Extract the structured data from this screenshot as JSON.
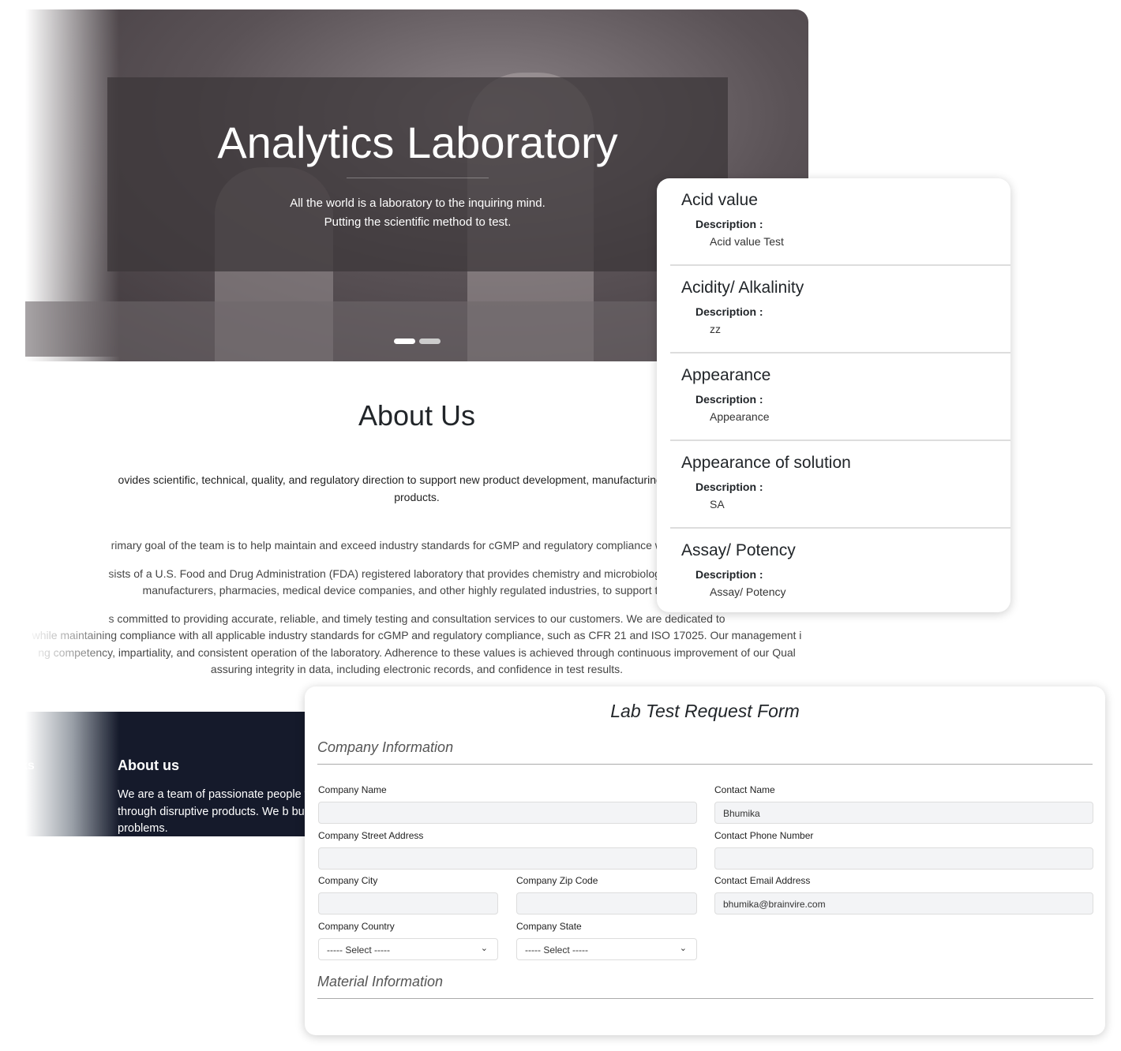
{
  "hero": {
    "title": "Analytics Laboratory",
    "line1": "All the world is a laboratory to the inquiring mind.",
    "line2": "Putting the scientific method to test."
  },
  "about": {
    "title": "About Us",
    "lead1": "ovides scientific, technical, quality, and regulatory direction to support new product development, manufacturing processes",
    "lead2": "products.",
    "p1": "rimary goal of the team is to help maintain and exceed industry standards for cGMP and regulatory compliance with a focus o",
    "p2a": "sists of a U.S. Food and Drug Administration (FDA) registered laboratory that provides chemistry and microbiological testing fo",
    "p2b": "manufacturers, pharmacies, medical device companies, and other highly regulated industries, to support their co",
    "p3a": "s committed to providing accurate, reliable, and timely testing and consultation services to our customers. We are dedicated to",
    "p3b": "while maintaining compliance with all applicable industry standards for cGMP and regulatory compliance, such as CFR 21 and ISO 17025. Our management i",
    "p3c": "ng competency, impartiality, and consistent operation of the laboratory. Adherence to these values is achieved through continuous improvement of our Qual",
    "p3d": "assuring integrity in data, including electronic records, and confidence in test results."
  },
  "footer": {
    "links": "ks",
    "title": "About us",
    "text": "We are a team of passionate people w life through disruptive products. We b business problems."
  },
  "tests": [
    {
      "name": "Acid value",
      "label": "Description :",
      "desc": "Acid value Test"
    },
    {
      "name": "Acidity/ Alkalinity",
      "label": "Description :",
      "desc": "zz"
    },
    {
      "name": "Appearance",
      "label": "Description :",
      "desc": "Appearance"
    },
    {
      "name": "Appearance of solution",
      "label": "Description :",
      "desc": "SA"
    },
    {
      "name": "Assay/ Potency",
      "label": "Description :",
      "desc": "Assay/ Potency"
    }
  ],
  "form": {
    "title": "Lab Test Request Form",
    "section1": "Company Information",
    "section2": "Material Information",
    "company_name": "Company Name",
    "street": "Company Street Address",
    "city": "Company City",
    "zip": "Company Zip Code",
    "country": "Company Country",
    "state": "Company State",
    "select": "----- Select -----",
    "contact_name": "Contact Name",
    "contact_name_value": "Bhumika",
    "phone": "Contact Phone Number",
    "email": "Contact Email Address",
    "email_value": "bhumika@brainvire.com"
  }
}
